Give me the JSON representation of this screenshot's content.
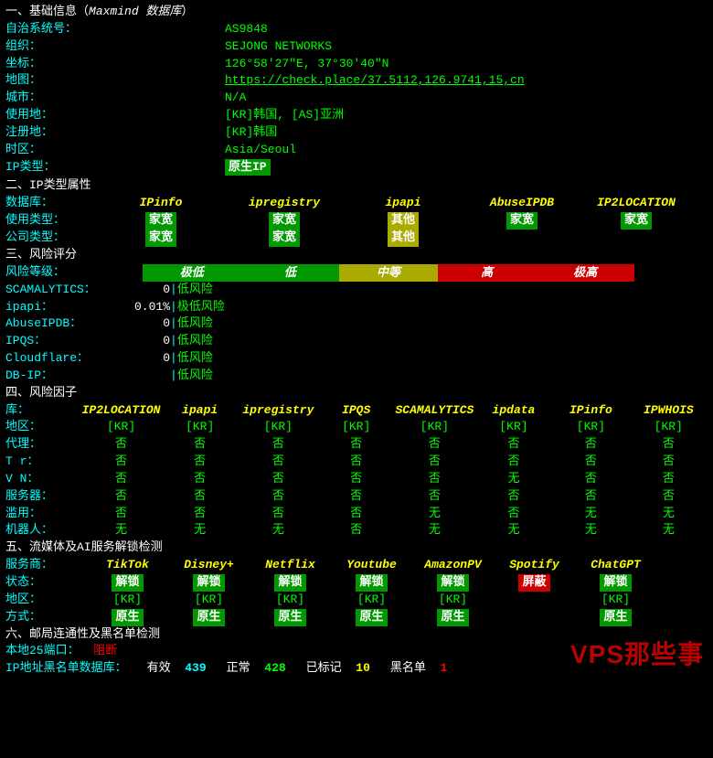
{
  "section1": {
    "title": "一、基础信息（",
    "title_db": "Maxmind 数据库",
    "title_end": "）",
    "rows": {
      "asn_label": "自治系统号：",
      "asn": "AS9848",
      "org_label": "组织：",
      "org": "SEJONG NETWORKS",
      "coord_label": "坐标：",
      "coord": "126°58′27″E, 37°30′40″N",
      "map_label": "地图：",
      "map": "https://check.place/37.5112,126.9741,15,cn",
      "city_label": "城市：",
      "city": "N/A",
      "use_label": "使用地：",
      "use_k1": "[KR]",
      "use_v1": "韩国",
      "use_sep": ", ",
      "use_k2": "[AS]",
      "use_v2": "亚洲",
      "reg_label": "注册地：",
      "reg_k": "[KR]",
      "reg_v": "韩国",
      "tz_label": "时区：",
      "tz": "Asia/Seoul",
      "iptype_label": "IP类型：",
      "iptype_badge": " 原生IP "
    }
  },
  "section2": {
    "title": "二、IP类型属性",
    "db_label": "数据库：",
    "dbs": [
      "IPinfo",
      "ipregistry",
      "ipapi",
      "AbuseIPDB",
      "IP2LOCATION"
    ],
    "use_label": "使用类型：",
    "use_vals": [
      {
        "t": "家宽",
        "c": "bg-green"
      },
      {
        "t": "家宽",
        "c": "bg-green"
      },
      {
        "t": "其他",
        "c": "bg-yellow"
      },
      {
        "t": "家宽",
        "c": "bg-green"
      },
      {
        "t": "家宽",
        "c": "bg-green"
      }
    ],
    "co_label": "公司类型：",
    "co_vals": [
      {
        "t": "家宽",
        "c": "bg-green"
      },
      {
        "t": "家宽",
        "c": "bg-green"
      },
      {
        "t": "其他",
        "c": "bg-yellow"
      },
      {
        "t": "",
        "c": ""
      },
      {
        "t": "",
        "c": ""
      }
    ]
  },
  "section3": {
    "title": "三、风险评分",
    "bar_label": "风险等级：",
    "bar": [
      {
        "t": "极低",
        "c": "bg-green"
      },
      {
        "t": "低",
        "c": "bg-green"
      },
      {
        "t": "中等",
        "c": "bg-yellow"
      },
      {
        "t": "高",
        "c": "bg-red"
      },
      {
        "t": "极高",
        "c": "bg-red"
      }
    ],
    "rows": [
      {
        "name": "SCAMALYTICS：",
        "val": "0",
        "res": "低风险"
      },
      {
        "name": "ipapi：",
        "val": "0.01%",
        "res": "极低风险"
      },
      {
        "name": "AbuseIPDB：",
        "val": "0",
        "res": "低风险"
      },
      {
        "name": "IPQS：",
        "val": "0",
        "res": "低风险"
      },
      {
        "name": "Cloudflare：",
        "val": "0",
        "res": "低风险"
      },
      {
        "name": "DB-IP：",
        "val": "",
        "res": "低风险"
      }
    ]
  },
  "section4": {
    "title": "四、风险因子",
    "db_label": "库：",
    "dbs": [
      "IP2LOCATION",
      "ipapi",
      "ipregistry",
      "IPQS",
      "SCAMALYTICS",
      "ipdata",
      "IPinfo",
      "IPWHOIS"
    ],
    "rows": [
      {
        "label": "地区：",
        "vals": [
          "[KR]",
          "[KR]",
          "[KR]",
          "[KR]",
          "[KR]",
          "[KR]",
          "[KR]",
          "[KR]"
        ]
      },
      {
        "label": "代理：",
        "vals": [
          "否",
          "否",
          "否",
          "否",
          "否",
          "否",
          "否",
          "否"
        ]
      },
      {
        "label": "T r：",
        "vals": [
          "否",
          "否",
          "否",
          "否",
          "否",
          "否",
          "否",
          "否"
        ]
      },
      {
        "label": "V N：",
        "vals": [
          "否",
          "否",
          "否",
          "否",
          "否",
          "无",
          "否",
          "否"
        ]
      },
      {
        "label": "服务器：",
        "vals": [
          "否",
          "否",
          "否",
          "否",
          "否",
          "否",
          "否",
          "否"
        ]
      },
      {
        "label": "滥用：",
        "vals": [
          "否",
          "否",
          "否",
          "否",
          "无",
          "否",
          "无",
          "无"
        ]
      },
      {
        "label": "机器人：",
        "vals": [
          "无",
          "无",
          "无",
          "否",
          "无",
          "无",
          "无",
          "无"
        ]
      }
    ]
  },
  "section5": {
    "title": "五、流媒体及AI服务解锁检测",
    "prov_label": "服务商：",
    "providers": [
      "TikTok",
      "Disney+",
      "Netflix",
      "Youtube",
      "AmazonPV",
      "Spotify",
      "ChatGPT"
    ],
    "status_label": "状态：",
    "status": [
      {
        "t": "解锁",
        "c": "bg-green"
      },
      {
        "t": "解锁",
        "c": "bg-green"
      },
      {
        "t": "解锁",
        "c": "bg-green"
      },
      {
        "t": "解锁",
        "c": "bg-green"
      },
      {
        "t": "解锁",
        "c": "bg-green"
      },
      {
        "t": "屏蔽",
        "c": "bg-red"
      },
      {
        "t": "解锁",
        "c": "bg-green"
      }
    ],
    "region_label": "地区：",
    "regions": [
      "[KR]",
      "[KR]",
      "[KR]",
      "[KR]",
      "[KR]",
      "",
      "[KR]"
    ],
    "mode_label": "方式：",
    "modes": [
      {
        "t": "原生",
        "c": "bg-green"
      },
      {
        "t": "原生",
        "c": "bg-green"
      },
      {
        "t": "原生",
        "c": "bg-green"
      },
      {
        "t": "原生",
        "c": "bg-green"
      },
      {
        "t": "原生",
        "c": "bg-green"
      },
      {
        "t": "",
        "c": ""
      },
      {
        "t": "原生",
        "c": "bg-green"
      }
    ]
  },
  "section6": {
    "title": "六、邮局连通性及黑名单检测",
    "port_label": "本地25端口：",
    "port_val": "阻断",
    "bl_label": "IP地址黑名单数据库：",
    "valid_label": "有效",
    "valid_val": "439",
    "normal_label": "正常",
    "normal_val": "428",
    "marked_label": "已标记",
    "marked_val": "10",
    "blacklist_label": "黑名单",
    "blacklist_val": "1"
  },
  "watermark": "VPS那些事"
}
